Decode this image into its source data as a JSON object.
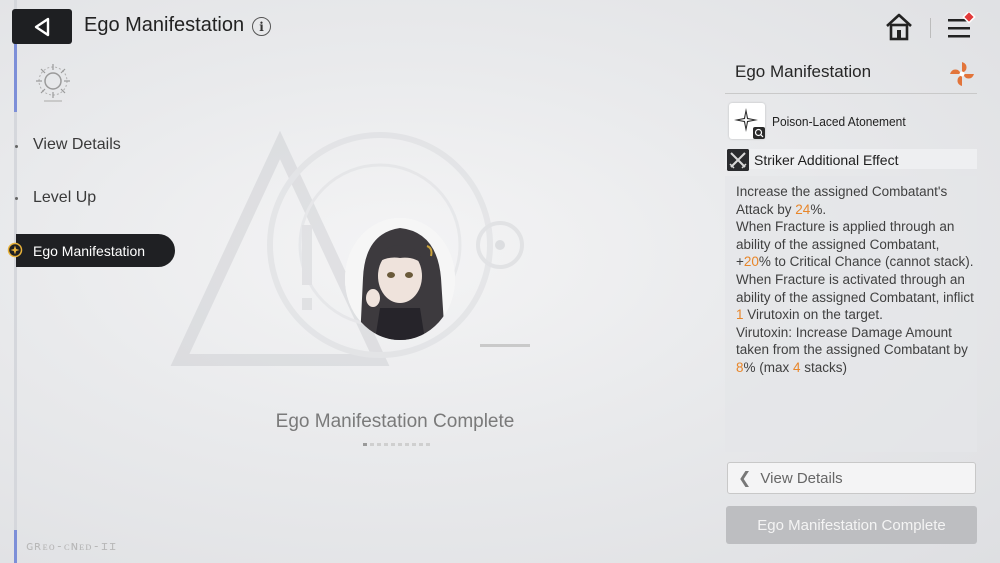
{
  "header": {
    "title": "Ego Manifestation",
    "info_icon": "info-icon",
    "back_icon": "back-arrow-icon",
    "home_icon": "home-icon",
    "menu_icon": "hamburger-menu-icon",
    "notification_color": "#e23a3a"
  },
  "sidebar": {
    "items": [
      {
        "label": "View Details",
        "active": false
      },
      {
        "label": "Level Up",
        "active": false
      },
      {
        "label": "Ego Manifestation",
        "active": true
      }
    ]
  },
  "main": {
    "status_text": "Ego Manifestation Complete",
    "footer_code": "ɢʀᴇᴏ-ᴄɴᴇᴅ-ɪɪ"
  },
  "panel": {
    "title": "Ego Manifestation",
    "skill_name": "Poison-Laced Atonement",
    "effect_label": "Striker Additional Effect",
    "description": [
      [
        {
          "t": "Increase the assigned Combatant's Attack by "
        },
        {
          "t": "24",
          "hl": true
        },
        {
          "t": "%."
        }
      ],
      [
        {
          "t": "When Fracture is applied through an ability of the assigned Combatant, +"
        },
        {
          "t": "20",
          "hl": true
        },
        {
          "t": "% to Critical Chance (cannot stack)."
        }
      ],
      [
        {
          "t": "When Fracture is activated through an ability of the assigned Combatant, inflict "
        },
        {
          "t": "1",
          "hl": true
        },
        {
          "t": " Virutoxin on the target."
        }
      ],
      [
        {
          "t": "Virutoxin: Increase Damage Amount taken from the assigned Combatant by "
        },
        {
          "t": "8",
          "hl": true
        },
        {
          "t": "% (max "
        },
        {
          "t": "4",
          "hl": true
        },
        {
          "t": " stacks)"
        }
      ]
    ],
    "highlight_color": "#e8862a"
  },
  "buttons": {
    "view_details": "View Details",
    "complete": "Ego Manifestation Complete"
  }
}
